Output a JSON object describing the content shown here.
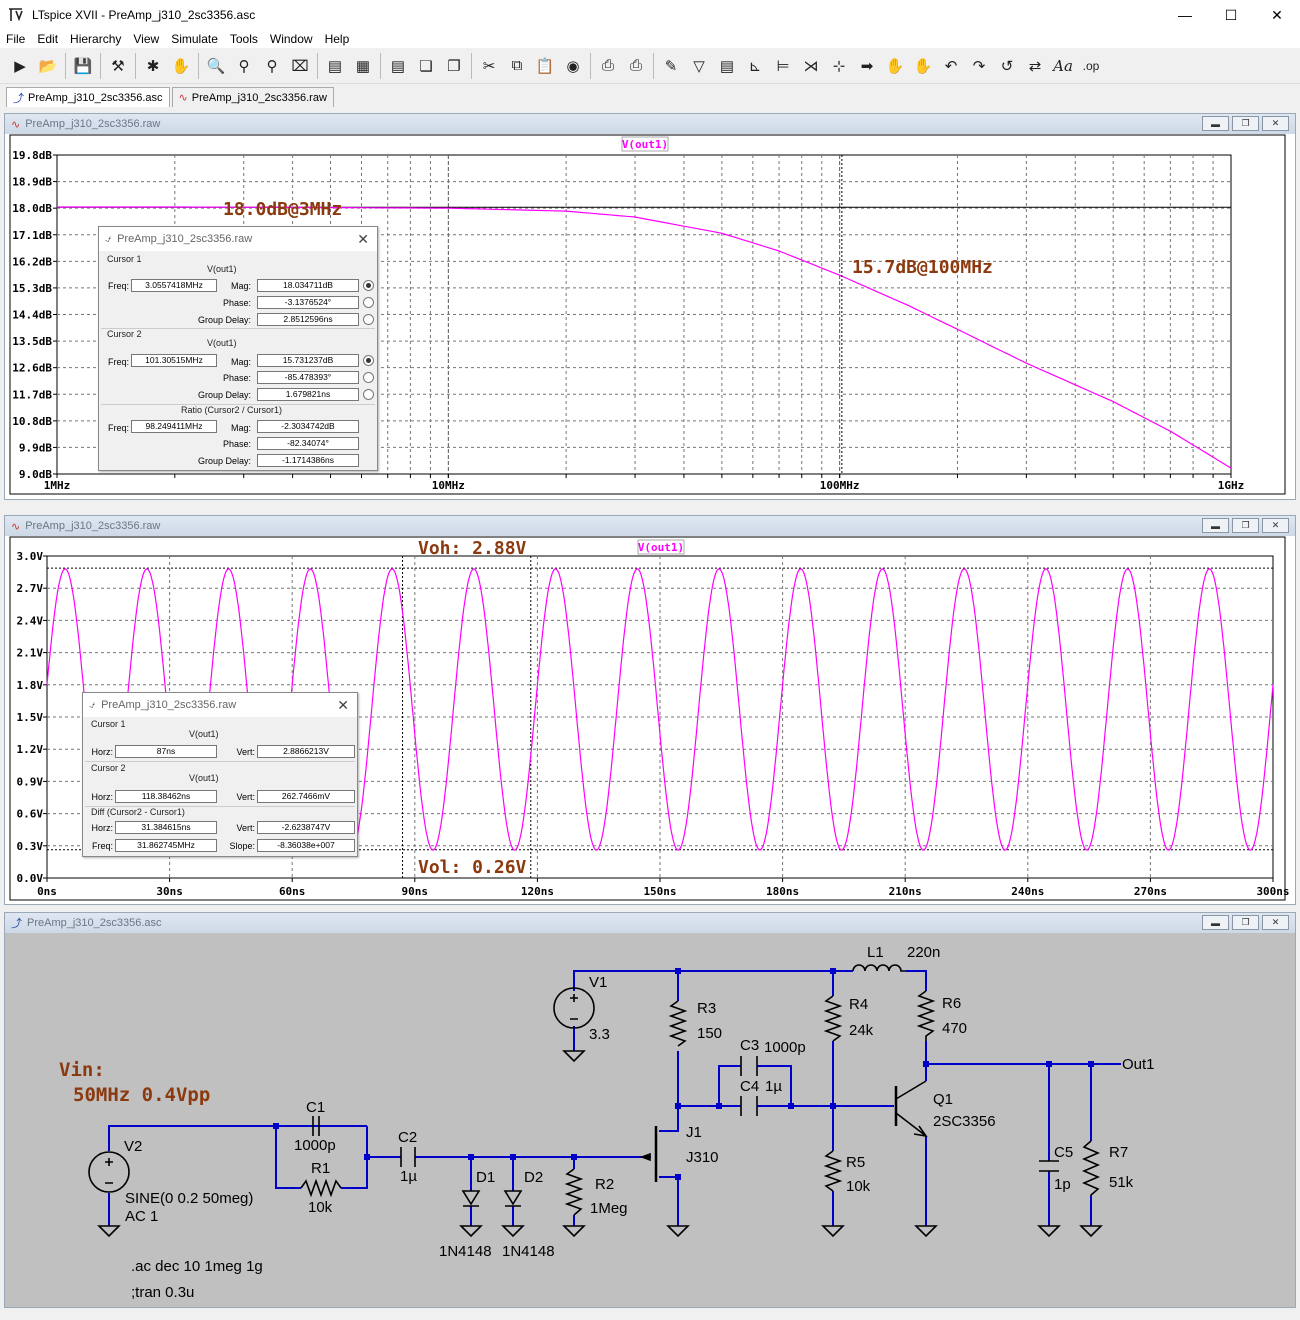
{
  "app": {
    "title": "LTspice XVII - PreAmp_j310_2sc3356.asc",
    "menu": [
      "File",
      "Edit",
      "Hierarchy",
      "View",
      "Simulate",
      "Tools",
      "Window",
      "Help"
    ],
    "tabs": [
      {
        "label": "PreAmp_j310_2sc3356.asc",
        "active": true
      },
      {
        "label": "PreAmp_j310_2sc3356.raw",
        "active": false
      }
    ]
  },
  "ac_window": {
    "title": "PreAmp_j310_2sc3356.raw",
    "trace_label": "V(out1)",
    "annotations": [
      "18.0dB@3MHz",
      "15.7dB@100MHz"
    ],
    "cursor_dialog": {
      "title": "PreAmp_j310_2sc3356.raw",
      "cursor1_label": "Cursor 1",
      "cursor1_trace": "V(out1)",
      "cursor1_freq": "3.0557418MHz",
      "cursor1_mag": "18.034711dB",
      "cursor1_phase": "-3.1376524°",
      "cursor1_gd": "2.8512596ns",
      "cursor2_label": "Cursor 2",
      "cursor2_trace": "V(out1)",
      "cursor2_freq": "101.30515MHz",
      "cursor2_mag": "15.731237dB",
      "cursor2_phase": "-85.478393°",
      "cursor2_gd": "1.679821ns",
      "ratio_label": "Ratio (Cursor2 / Cursor1)",
      "ratio_freq": "98.249411MHz",
      "ratio_mag": "-2.3034742dB",
      "ratio_phase": "-82.34074°",
      "ratio_gd": "-1.1714386ns",
      "lbl_freq": "Freq:",
      "lbl_mag": "Mag:",
      "lbl_phase": "Phase:",
      "lbl_gd": "Group Delay:"
    }
  },
  "tran_window": {
    "title": "PreAmp_j310_2sc3356.raw",
    "trace_label": "V(out1)",
    "annotations": [
      "Voh: 2.88V",
      "Vol: 0.26V"
    ],
    "cursor_dialog": {
      "title": "PreAmp_j310_2sc3356.raw",
      "cursor1_label": "Cursor 1",
      "cursor1_trace": "V(out1)",
      "cursor1_horz": "87ns",
      "cursor1_vert": "2.8866213V",
      "cursor2_label": "Cursor 2",
      "cursor2_trace": "V(out1)",
      "cursor2_horz": "118.38462ns",
      "cursor2_vert": "262.7466mV",
      "diff_label": "Diff (Cursor2 - Cursor1)",
      "diff_horz": "31.384615ns",
      "diff_vert": "-2.6238747V",
      "diff_freq": "31.862745MHz",
      "diff_slope": "-8.36038e+007",
      "lbl_horz": "Horz:",
      "lbl_vert": "Vert:",
      "lbl_freq": "Freq:",
      "lbl_slope": "Slope:"
    }
  },
  "schematic_window": {
    "title": "PreAmp_j310_2sc3356.asc",
    "labels": {
      "vin1": "Vin:",
      "vin2": "50MHz 0.4Vpp",
      "v1": "V1",
      "v1val": "3.3",
      "v2": "V2",
      "v2val1": "SINE(0 0.2 50meg)",
      "v2val2": "AC 1",
      "c1": "C1",
      "c1val": "1000p",
      "r1": "R1",
      "r1val": "10k",
      "c2": "C2",
      "c2val": "1µ",
      "d1": "D1",
      "d1val": "1N4148",
      "d2": "D2",
      "d2val": "1N4148",
      "r2": "R2",
      "r2val": "1Meg",
      "r3": "R3",
      "r3val": "150",
      "j1": "J1",
      "j1val": "J310",
      "c3": "C3",
      "c3val": "1000p",
      "c4": "C4",
      "c4val": "1µ",
      "l1": "L1",
      "l1val": "220n",
      "r4": "R4",
      "r4val": "24k",
      "r5": "R5",
      "r5val": "10k",
      "r6": "R6",
      "r6val": "470",
      "q1": "Q1",
      "q1val": "2SC3356",
      "c5": "C5",
      "c5val": "1p",
      "r7": "R7",
      "r7val": "51k",
      "out": "Out1",
      "cmd1": ".ac dec 10 1meg 1g",
      "cmd2": ";tran 0.3u"
    }
  },
  "chart_data": [
    {
      "type": "line",
      "xscale": "log",
      "xlim_hz": [
        1000000,
        1000000000
      ],
      "ylim": [
        9.0,
        19.8
      ],
      "y_unit": "dB",
      "x_ticks": [
        "1MHz",
        "10MHz",
        "100MHz",
        "1GHz"
      ],
      "y_ticks": [
        "19.8dB",
        "18.9dB",
        "18.0dB",
        "17.1dB",
        "16.2dB",
        "15.3dB",
        "14.4dB",
        "13.5dB",
        "12.6dB",
        "11.7dB",
        "10.8dB",
        "9.9dB",
        "9.0dB"
      ],
      "series": [
        {
          "name": "V(out1)",
          "color": "#ff00ff",
          "x": [
            1000000,
            2000000,
            3000000,
            5000000,
            10000000,
            20000000,
            30000000,
            50000000,
            70000000,
            100000000,
            150000000,
            200000000,
            300000000,
            500000000,
            700000000,
            1000000000
          ],
          "y": [
            18.04,
            18.04,
            18.03,
            18.02,
            18.0,
            17.9,
            17.7,
            17.15,
            16.55,
            15.73,
            14.7,
            13.9,
            12.75,
            11.45,
            10.45,
            9.2
          ]
        }
      ]
    },
    {
      "type": "line",
      "xlim_ns": [
        0,
        300
      ],
      "ylim": [
        0.0,
        3.0
      ],
      "y_unit": "V",
      "x_ticks": [
        "0ns",
        "30ns",
        "60ns",
        "90ns",
        "120ns",
        "150ns",
        "180ns",
        "210ns",
        "240ns",
        "270ns",
        "300ns"
      ],
      "y_ticks": [
        "3.0V",
        "2.7V",
        "2.4V",
        "2.1V",
        "1.8V",
        "1.5V",
        "1.2V",
        "0.9V",
        "0.6V",
        "0.3V",
        "0.0V"
      ],
      "series": [
        {
          "name": "V(out1)",
          "color": "#ff00ff",
          "shape": "sine",
          "frequency_mhz": 50,
          "vmax": 2.88,
          "vmin": 0.26,
          "start_v": 1.8
        }
      ]
    }
  ]
}
